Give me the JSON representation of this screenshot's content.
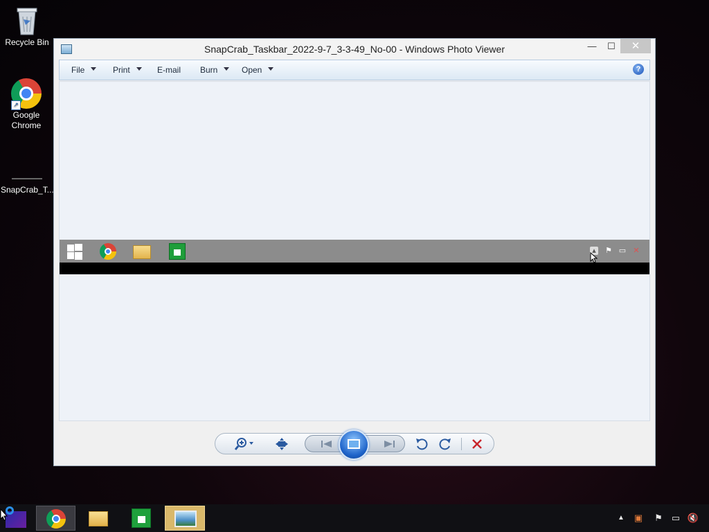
{
  "desktop": {
    "icons": [
      {
        "label": "Recycle Bin"
      },
      {
        "label": "Google Chrome"
      },
      {
        "label": "SnapCrab_T..."
      }
    ]
  },
  "window": {
    "title": "SnapCrab_Taskbar_2022-9-7_3-3-49_No-00 - Windows Photo Viewer",
    "controls": {
      "minimize": "—",
      "maximize": "☐",
      "close": "✕"
    },
    "menu": [
      {
        "label": "File",
        "has_dropdown": true
      },
      {
        "label": "Print",
        "has_dropdown": true
      },
      {
        "label": "E-mail",
        "has_dropdown": false
      },
      {
        "label": "Burn",
        "has_dropdown": true
      },
      {
        "label": "Open",
        "has_dropdown": true
      }
    ],
    "help_label": "?"
  },
  "toolbar_bottom": {
    "zoom": "zoom-icon",
    "fit": "actual-size-icon",
    "previous": "previous-icon",
    "slideshow": "slideshow-icon",
    "next": "next-icon",
    "rotate_left": "rotate-counterclockwise-icon",
    "rotate_right": "rotate-clockwise-icon",
    "delete": "delete-icon"
  },
  "taskbar": {
    "items": [
      "start",
      "Google Chrome",
      "File Explorer",
      "Store",
      "Windows Photo Viewer"
    ],
    "tray": [
      "show-hidden-icons",
      "notification-icon",
      "action-center-flag-icon",
      "network-icon",
      "volume-muted-icon"
    ]
  },
  "colors": {
    "viewer_background": "#eef2f8",
    "photo_taskbar_gray": "#8c8c8c",
    "active_taskbar_item": "#d9b86a",
    "close_hover": "#c7c7c7"
  }
}
